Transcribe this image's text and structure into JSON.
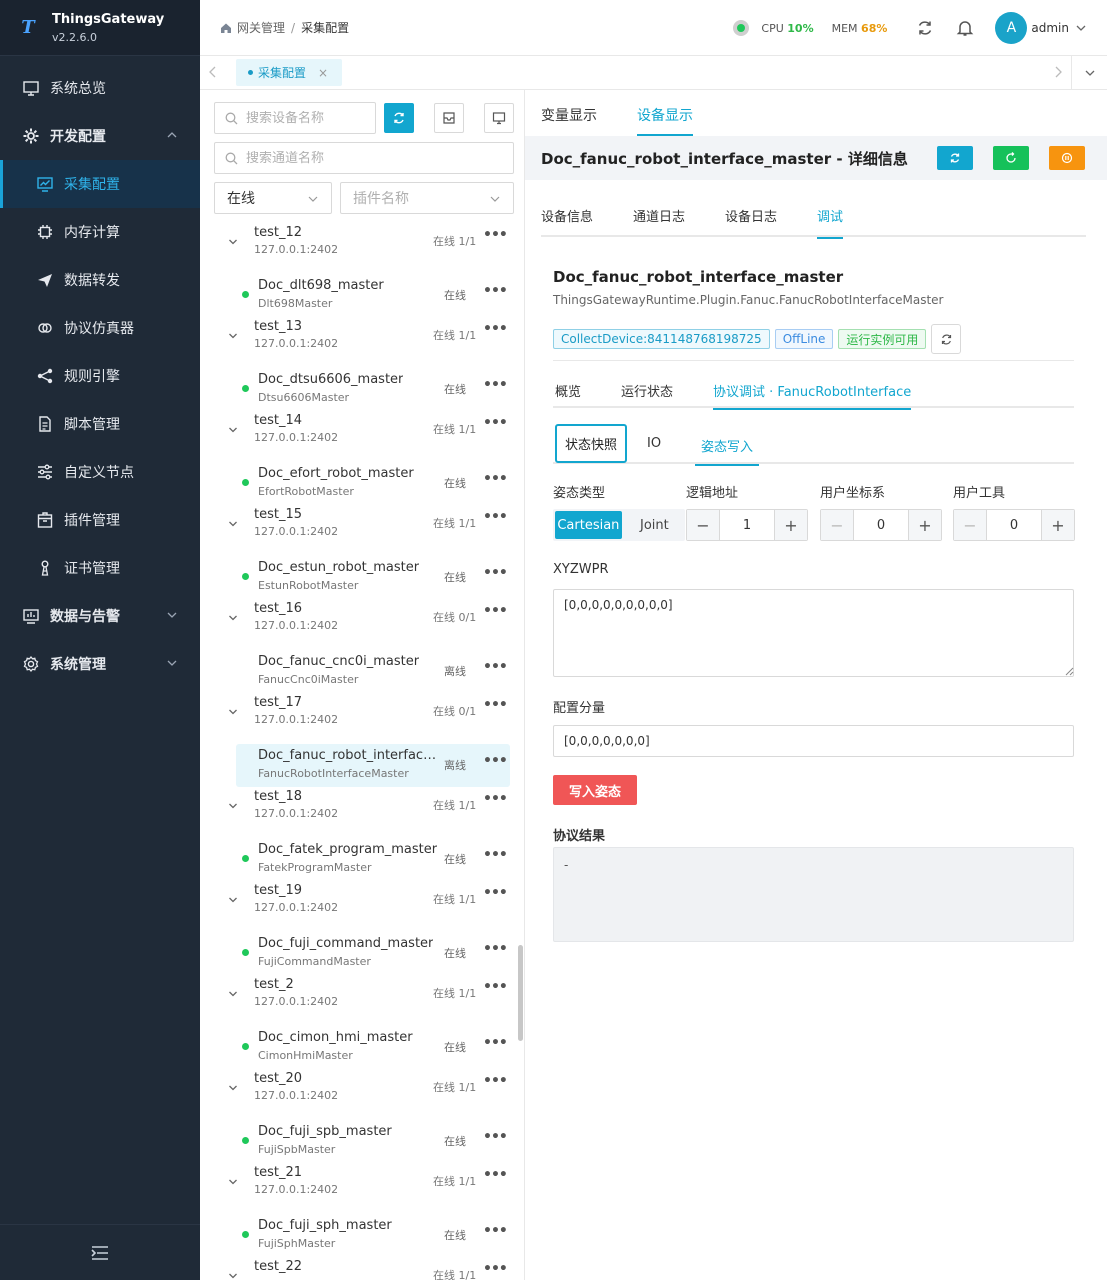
{
  "app": {
    "title": "ThingsGateway",
    "version": "v2.2.6.0"
  },
  "sidebar": {
    "items": [
      {
        "label": "系统总览",
        "icon": "monitor-icon",
        "level": "top"
      },
      {
        "label": "开发配置",
        "icon": "gear-icon",
        "level": "group",
        "expanded": true
      },
      {
        "label": "采集配置",
        "icon": "chart-monitor-icon",
        "level": "sub",
        "active": true
      },
      {
        "label": "内存计算",
        "icon": "chip-icon",
        "level": "sub"
      },
      {
        "label": "数据转发",
        "icon": "send-icon",
        "level": "sub"
      },
      {
        "label": "协议仿真器",
        "icon": "link-icon",
        "level": "sub"
      },
      {
        "label": "规则引擎",
        "icon": "share-icon",
        "level": "sub"
      },
      {
        "label": "脚本管理",
        "icon": "document-icon",
        "level": "sub"
      },
      {
        "label": "自定义节点",
        "icon": "sliders-icon",
        "level": "sub"
      },
      {
        "label": "插件管理",
        "icon": "package-icon",
        "level": "sub"
      },
      {
        "label": "证书管理",
        "icon": "certificate-icon",
        "level": "sub"
      },
      {
        "label": "数据与告警",
        "icon": "data-screen-icon",
        "level": "group",
        "expanded": false
      },
      {
        "label": "系统管理",
        "icon": "settings-icon",
        "level": "group",
        "expanded": false
      }
    ]
  },
  "header": {
    "breadcrumb": [
      "网关管理",
      "采集配置"
    ],
    "cpu_label": "CPU",
    "cpu_value": "10%",
    "mem_label": "MEM",
    "mem_value": "68%",
    "avatar_letter": "A",
    "user": "admin"
  },
  "page_tabs": [
    {
      "label": "采集配置",
      "close": "×"
    }
  ],
  "device_panel": {
    "device_search_placeholder": "搜索设备名称",
    "channel_search_placeholder": "搜索通道名称",
    "status_filter": "在线",
    "plugin_filter_placeholder": "插件名称",
    "groups": [
      {
        "name": "test_12",
        "addr": "127.0.0.1:2402",
        "status": "在线 1/1",
        "device": {
          "name": "Doc_dlt698_master",
          "plugin": "Dlt698Master",
          "status": "在线",
          "online": true
        }
      },
      {
        "name": "test_13",
        "addr": "127.0.0.1:2402",
        "status": "在线 1/1",
        "device": {
          "name": "Doc_dtsu6606_master",
          "plugin": "Dtsu6606Master",
          "status": "在线",
          "online": true
        }
      },
      {
        "name": "test_14",
        "addr": "127.0.0.1:2402",
        "status": "在线 1/1",
        "device": {
          "name": "Doc_efort_robot_master",
          "plugin": "EfortRobotMaster",
          "status": "在线",
          "online": true
        }
      },
      {
        "name": "test_15",
        "addr": "127.0.0.1:2402",
        "status": "在线 1/1",
        "device": {
          "name": "Doc_estun_robot_master",
          "plugin": "EstunRobotMaster",
          "status": "在线",
          "online": true
        }
      },
      {
        "name": "test_16",
        "addr": "127.0.0.1:2402",
        "status": "在线 0/1",
        "device": {
          "name": "Doc_fanuc_cnc0i_master",
          "plugin": "FanucCnc0iMaster",
          "status": "离线",
          "online": false
        }
      },
      {
        "name": "test_17",
        "addr": "127.0.0.1:2402",
        "status": "在线 0/1",
        "device": {
          "name": "Doc_fanuc_robot_interface_master",
          "plugin": "FanucRobotInterfaceMaster",
          "status": "离线",
          "online": false,
          "selected": true
        }
      },
      {
        "name": "test_18",
        "addr": "127.0.0.1:2402",
        "status": "在线 1/1",
        "device": {
          "name": "Doc_fatek_program_master",
          "plugin": "FatekProgramMaster",
          "status": "在线",
          "online": true
        }
      },
      {
        "name": "test_19",
        "addr": "127.0.0.1:2402",
        "status": "在线 1/1",
        "device": {
          "name": "Doc_fuji_command_master",
          "plugin": "FujiCommandMaster",
          "status": "在线",
          "online": true
        }
      },
      {
        "name": "test_2",
        "addr": "127.0.0.1:2402",
        "status": "在线 1/1",
        "device": {
          "name": "Doc_cimon_hmi_master",
          "plugin": "CimonHmiMaster",
          "status": "在线",
          "online": true
        }
      },
      {
        "name": "test_20",
        "addr": "127.0.0.1:2402",
        "status": "在线 1/1",
        "device": {
          "name": "Doc_fuji_spb_master",
          "plugin": "FujiSpbMaster",
          "status": "在线",
          "online": true
        }
      },
      {
        "name": "test_21",
        "addr": "127.0.0.1:2402",
        "status": "在线 1/1",
        "device": {
          "name": "Doc_fuji_sph_master",
          "plugin": "FujiSphMaster",
          "status": "在线",
          "online": true
        }
      },
      {
        "name": "test_22",
        "addr": "",
        "status": "在线 1/1",
        "device": null
      }
    ]
  },
  "right": {
    "view_tabs": [
      "变量显示",
      "设备显示"
    ],
    "detail_title": "Doc_fanuc_robot_interface_master - 详细信息",
    "info_tabs": [
      "设备信息",
      "通道日志",
      "设备日志",
      "调试"
    ],
    "device_name": "Doc_fanuc_robot_interface_master",
    "device_class": "ThingsGatewayRuntime.Plugin.Fanuc.FanucRobotInterfaceMaster",
    "tags": [
      "CollectDevice:841148768198725",
      "OffLine",
      "运行实例可用"
    ],
    "sub_tabs": [
      "概览",
      "运行状态",
      "协议调试 · FanucRobotInterface"
    ],
    "third_tabs": [
      "状态快照",
      "IO",
      "姿态写入"
    ],
    "form": {
      "pose_type_label": "姿态类型",
      "pose_options": [
        "Cartesian",
        "Joint"
      ],
      "logic_addr_label": "逻辑地址",
      "logic_addr_value": "1",
      "user_frame_label": "用户坐标系",
      "user_frame_value": "0",
      "user_tool_label": "用户工具",
      "user_tool_value": "0",
      "minus": "−",
      "plus": "+",
      "xyzwpr_label": "XYZWPR",
      "xyzwpr_value": "[0,0,0,0,0,0,0,0,0]",
      "config_label": "配置分量",
      "config_value": "[0,0,0,0,0,0,0]",
      "write_button": "写入姿态",
      "result_label": "协议结果",
      "result_value": "-"
    }
  },
  "colors": {
    "accent": "#12a6cf",
    "sidebar_bg": "#1f2a37",
    "danger": "#f05656",
    "online": "#1fc85a",
    "refresh_green": "#16c15a",
    "refresh_orange": "#f7940f"
  }
}
